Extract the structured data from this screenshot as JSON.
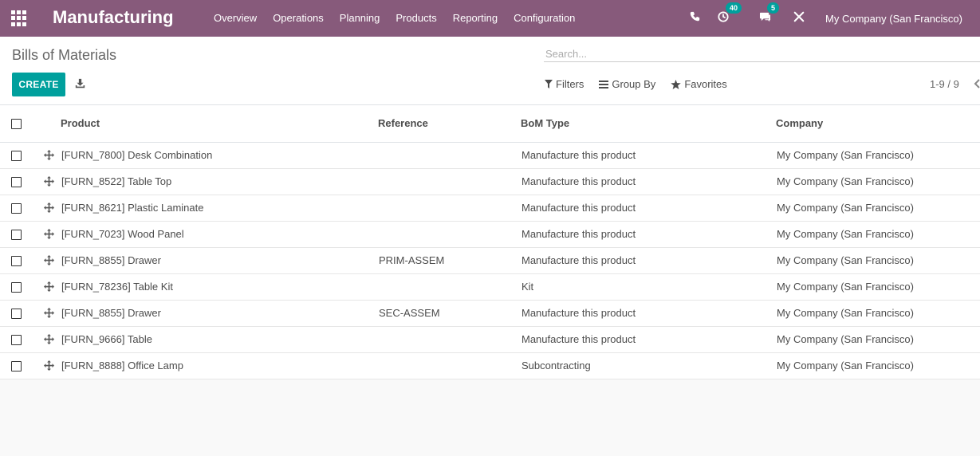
{
  "navbar": {
    "brand": "Manufacturing",
    "menu": [
      "Overview",
      "Operations",
      "Planning",
      "Products",
      "Reporting",
      "Configuration"
    ],
    "activities_count": "40",
    "messages_count": "5",
    "company": "My Company (San Francisco)"
  },
  "control_panel": {
    "breadcrumb": "Bills of Materials",
    "search_placeholder": "Search...",
    "create_label": "CREATE",
    "filters_label": "Filters",
    "group_by_label": "Group By",
    "favorites_label": "Favorites",
    "pager": "1-9 / 9"
  },
  "table": {
    "columns": [
      "Product",
      "Reference",
      "BoM Type",
      "Company"
    ],
    "rows": [
      {
        "product": "[FURN_7800] Desk Combination",
        "reference": "",
        "bom_type": "Manufacture this product",
        "company": "My Company (San Francisco)"
      },
      {
        "product": "[FURN_8522] Table Top",
        "reference": "",
        "bom_type": "Manufacture this product",
        "company": "My Company (San Francisco)"
      },
      {
        "product": "[FURN_8621] Plastic Laminate",
        "reference": "",
        "bom_type": "Manufacture this product",
        "company": "My Company (San Francisco)"
      },
      {
        "product": "[FURN_7023] Wood Panel",
        "reference": "",
        "bom_type": "Manufacture this product",
        "company": "My Company (San Francisco)"
      },
      {
        "product": "[FURN_8855] Drawer",
        "reference": "PRIM-ASSEM",
        "bom_type": "Manufacture this product",
        "company": "My Company (San Francisco)"
      },
      {
        "product": "[FURN_78236] Table Kit",
        "reference": "",
        "bom_type": "Kit",
        "company": "My Company (San Francisco)"
      },
      {
        "product": "[FURN_8855] Drawer",
        "reference": "SEC-ASSEM",
        "bom_type": "Manufacture this product",
        "company": "My Company (San Francisco)"
      },
      {
        "product": "[FURN_9666] Table",
        "reference": "",
        "bom_type": "Manufacture this product",
        "company": "My Company (San Francisco)"
      },
      {
        "product": "[FURN_8888] Office Lamp",
        "reference": "",
        "bom_type": "Subcontracting",
        "company": "My Company (San Francisco)"
      }
    ]
  },
  "colors": {
    "navbar": "#875a7b",
    "primary_button": "#00a09d",
    "badge": "#00a09d"
  },
  "icons": [
    "apps-grid-icon",
    "phone-icon",
    "clock-icon",
    "chat-icon",
    "tools-icon",
    "download-icon",
    "filter-icon",
    "group-by-icon",
    "star-icon",
    "chevron-left-icon",
    "drag-handle-icon"
  ]
}
